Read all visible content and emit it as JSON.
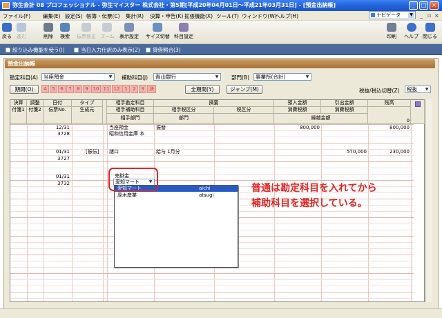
{
  "window": {
    "title": "弥生会計 08 プロフェッショナル - 弥生マイスター 株式会社・第5期[平成20年04月01日～平成21年03月31日] - [預金出納帳]"
  },
  "menu": [
    "ファイル(F)",
    "編集(E)",
    "設定(S)",
    "帳簿・伝票(C)",
    "集計(R)",
    "決算・申告(K)",
    "拡張機能(X)",
    "ツール(T)",
    "ウィンドウ(W)",
    "ヘルプ(H)"
  ],
  "navi": {
    "label": "ナビゲータ"
  },
  "toolbar": {
    "back": "戻る",
    "forward": "進む",
    "delete": "削除",
    "search": "検索",
    "trace": "伝票修正",
    "zoom": "ズーム",
    "display_settings": "表示設定",
    "size_switch": "サイズ切替",
    "account_settings": "科目設定",
    "print": "印刷",
    "help": "ヘルプ",
    "close": "閉じる"
  },
  "options": {
    "filter": "絞り込み機能を使う(I)",
    "today_only": "当日入力仕訳のみ表示(2)",
    "balance_check": "貸借照合(3)"
  },
  "ledger": {
    "title": "預金出納帳",
    "account_label": "勘定科目(A)",
    "account_value": "当座預金",
    "sub_account_label": "補助科目(J)",
    "sub_account_value": "青山銀行",
    "department_label": "部門(B)",
    "department_value": "事業所(合計)",
    "period_button": "期間(O)",
    "months": [
      "4",
      "5",
      "6",
      "7",
      "8",
      "9",
      "10",
      "11",
      "12",
      "1",
      "2",
      "3",
      "決"
    ],
    "full_period_button": "全期間(Y)",
    "jump_button": "ジャンプ(M)",
    "tax_label": "税抜/税込切替(Z)",
    "tax_value": "税抜"
  },
  "grid_headers": {
    "row1": [
      "決算",
      "調整",
      "日付",
      "タイプ",
      "相手勘定科目",
      "摘要",
      "預入金額",
      "引出金額",
      "残高"
    ],
    "row2": [
      "付箋1",
      "付箋2",
      "伝票No.",
      "生成元",
      "相手補助科目",
      "相手税区分",
      "税区分",
      "消費税額",
      "消費税額"
    ],
    "row3": [
      "相手部門",
      "部門",
      "繰越金額"
    ]
  },
  "rows": [
    {
      "date": "",
      "no": "",
      "type": "",
      "account": "",
      "sub": "",
      "memo": "",
      "deposit": "",
      "withdraw": "繰越金額",
      "balance": "0"
    },
    {
      "date": "12/31",
      "no": "3728",
      "type": "",
      "account": "当座預金",
      "sub": "昭和信用金庫 本",
      "memo": "振替",
      "deposit": "800,000",
      "withdraw": "",
      "balance": "800,000"
    },
    {
      "date": "01/31",
      "no": "3727",
      "type": "[振伝]",
      "account": "諸口",
      "sub": "",
      "memo": "給与 1月分",
      "deposit": "",
      "withdraw": "570,000",
      "balance": "230,000"
    },
    {
      "date": "01/31",
      "no": "3732",
      "type": "",
      "account": "売掛金",
      "sub": "愛知マート",
      "memo": "",
      "deposit": "",
      "withdraw": "",
      "balance": ""
    }
  ],
  "dropdown": {
    "items": [
      {
        "name": "愛知マート",
        "code": "aichi",
        "selected": true
      },
      {
        "name": "厚木産業",
        "code": "atsugi",
        "selected": false
      }
    ]
  },
  "annotation": {
    "line1": "普通は勘定科目を入れてから",
    "line2": "補助科目を選択している。",
    "color": "#e02525"
  }
}
